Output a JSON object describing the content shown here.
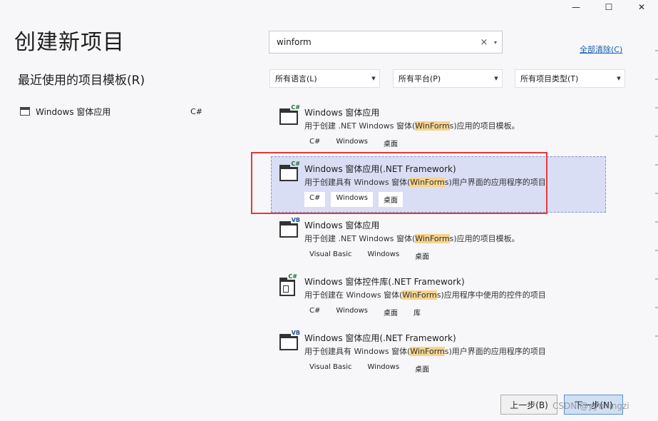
{
  "window": {
    "minimize_glyph": "—",
    "maximize_glyph": "☐",
    "close_glyph": "✕"
  },
  "page_title": "创建新项目",
  "recent": {
    "title": "最近使用的项目模板(R)",
    "items": [
      {
        "label": "Windows 窗体应用",
        "language": "C#"
      }
    ]
  },
  "search": {
    "value": "winform",
    "clear_glyph": "×",
    "dropdown_glyph": "▾"
  },
  "clear_all_label": "全部清除(C)",
  "filters": {
    "language": "所有语言(L)",
    "platform": "所有平台(P)",
    "project_type": "所有项目类型(T)"
  },
  "templates": [
    {
      "title": "Windows 窗体应用",
      "desc_before": "用于创建 .NET Windows 窗体(",
      "desc_highlight": "WinForm",
      "desc_after": "s)应用的项目模板。",
      "badge": "C#",
      "tags": [
        "C#",
        "Windows",
        "桌面"
      ]
    },
    {
      "title": "Windows 窗体应用(.NET Framework)",
      "desc_before": "用于创建具有 Windows 窗体(",
      "desc_highlight": "WinForm",
      "desc_after": "s)用户界面的应用程序的项目",
      "badge": "C#",
      "tags": [
        "C#",
        "Windows",
        "桌面"
      ],
      "selected": true
    },
    {
      "title": "Windows 窗体应用",
      "desc_before": "用于创建 .NET Windows 窗体(",
      "desc_highlight": "WinForm",
      "desc_after": "s)应用的项目模板。",
      "badge": "VB",
      "tags": [
        "Visual Basic",
        "Windows",
        "桌面"
      ]
    },
    {
      "title": "Windows 窗体控件库(.NET Framework)",
      "desc_before": "用于创建在 Windows 窗体(",
      "desc_highlight": "WinForm",
      "desc_after": "s)应用程序中使用的控件的项目",
      "badge": "C#",
      "tags": [
        "C#",
        "Windows",
        "桌面",
        "库"
      ]
    },
    {
      "title": "Windows 窗体应用(.NET Framework)",
      "desc_before": "用于创建具有 Windows 窗体(",
      "desc_highlight": "WinForm",
      "desc_after": "s)用户界面的应用程序的项目",
      "badge": "VB",
      "tags": [
        "Visual Basic",
        "Windows",
        "桌面"
      ]
    }
  ],
  "buttons": {
    "back": "上一步(B)",
    "next": "下一步(N)"
  },
  "watermark": "CSDN @yyuningzi",
  "colors": {
    "selection_bg": "#d9def5",
    "highlight": "#f6d38e",
    "annotation_red": "#e03a3a",
    "link_blue": "#1a5fb4"
  }
}
